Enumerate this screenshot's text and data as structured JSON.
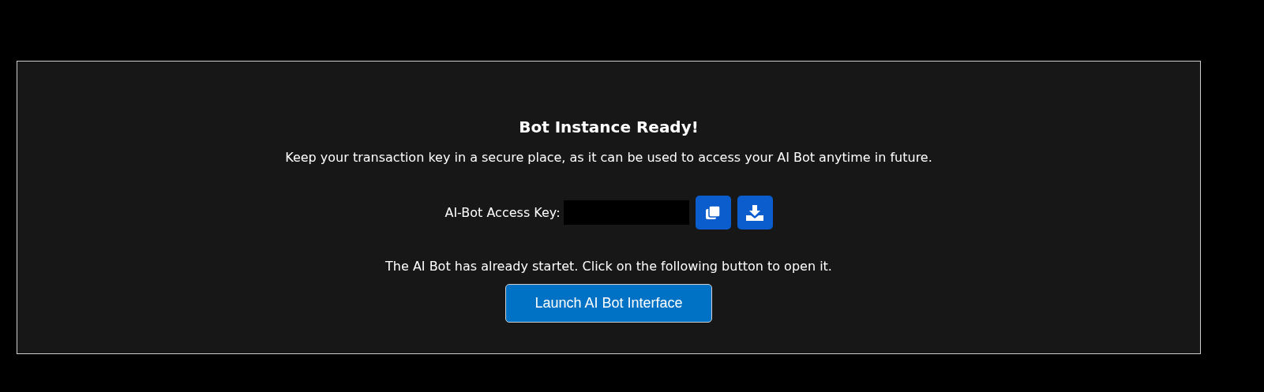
{
  "title": "Bot Instance Ready!",
  "notice": "Keep your transaction key in a secure place, as it can be used to access your AI Bot anytime in future.",
  "access_key": {
    "label": "AI-Bot Access Key:"
  },
  "status_text": "The AI Bot has already startet. Click on the following button to open it.",
  "launch_button": "Launch AI Bot Interface"
}
